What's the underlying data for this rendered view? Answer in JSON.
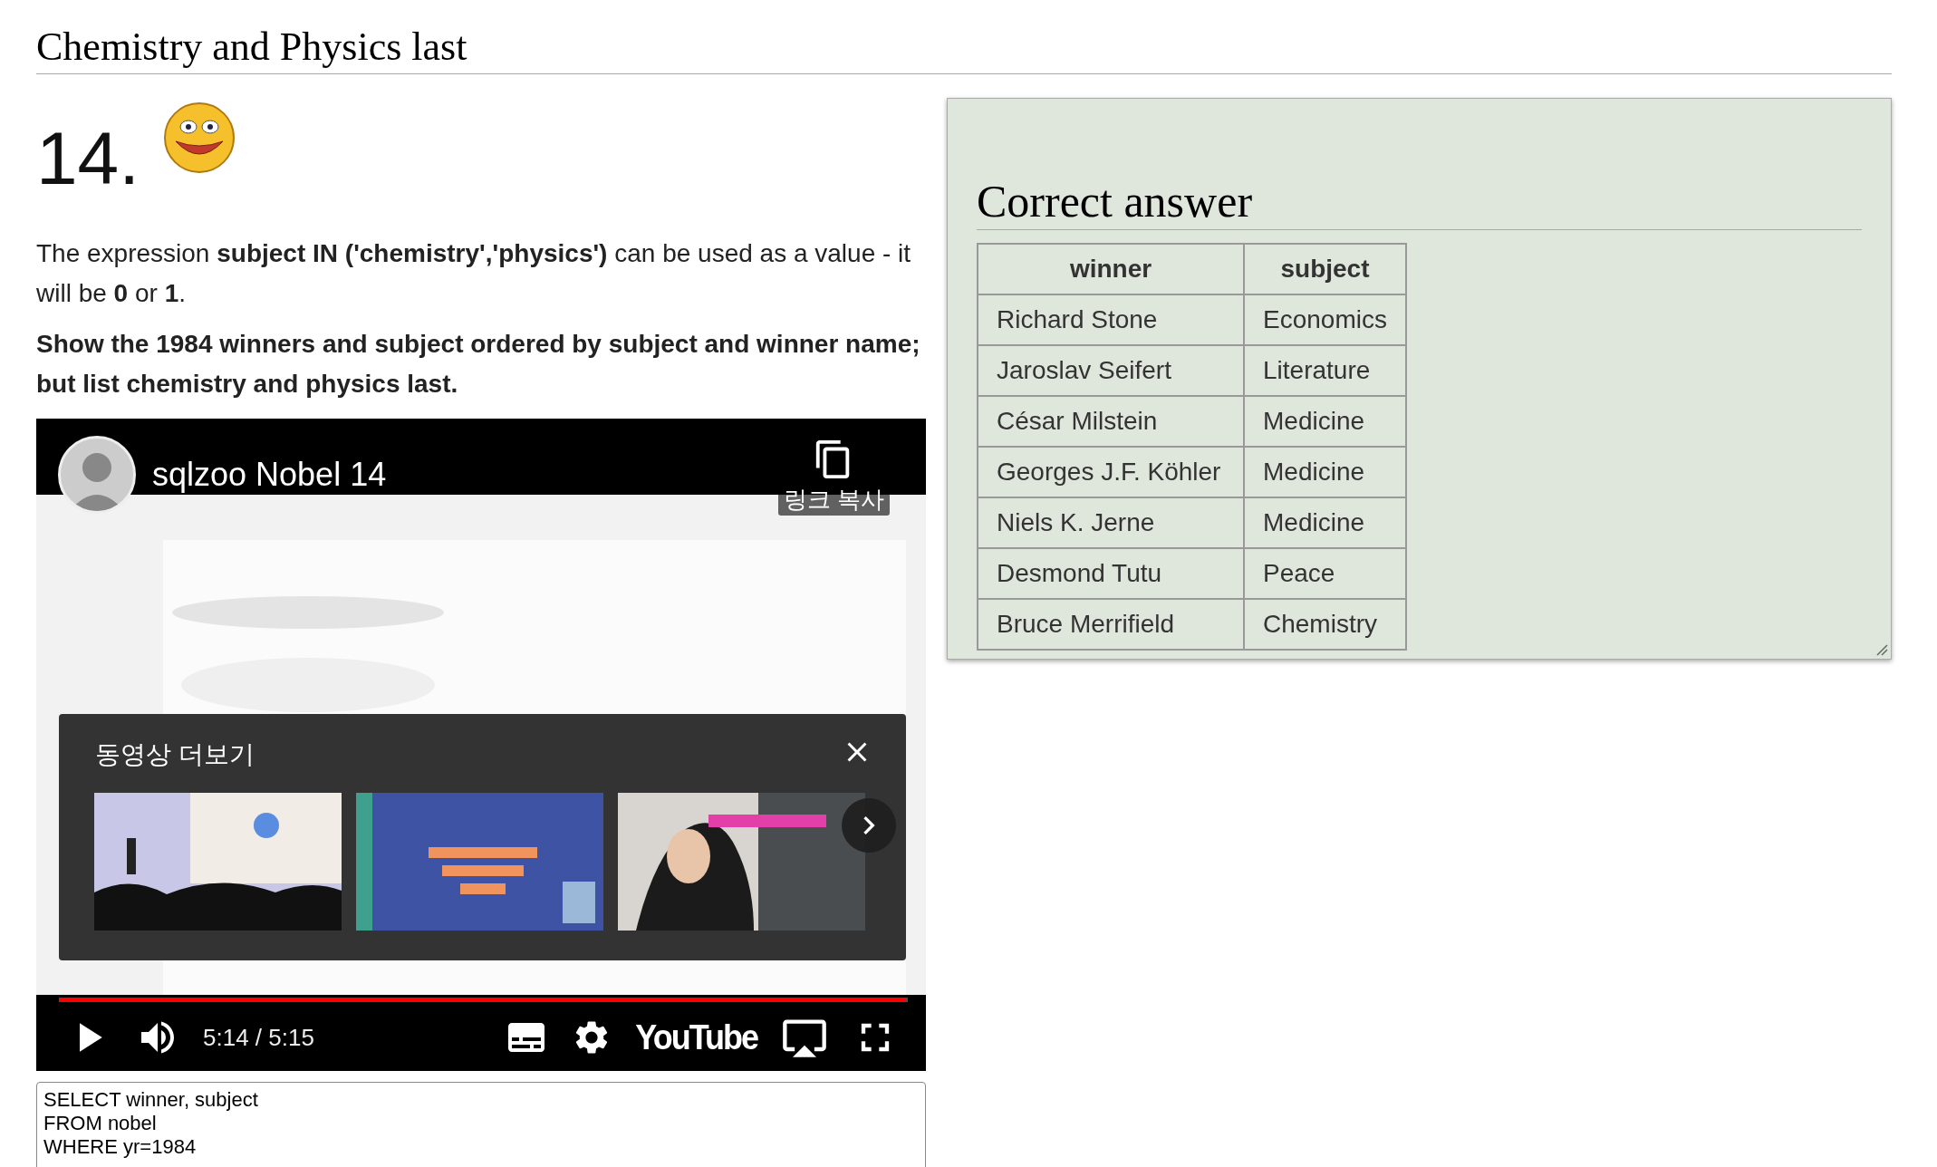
{
  "page_title": "Chemistry and Physics last",
  "question": {
    "number": "14.",
    "intro": "The expression **subject IN ('chemistry','physics')** can be used as a value - it will be **0** or **1**.",
    "task": "Show the 1984 winners and subject ordered by subject and winner name; but list chemistry and physics last."
  },
  "video": {
    "title": "sqlzoo Nobel 14",
    "copy_link": "링크 복사",
    "more_videos": {
      "title": "동영상 더보기"
    },
    "progress": {
      "level": 0.997
    },
    "time": "5:14 / 5:15",
    "logo": "YouTube"
  },
  "sql": {
    "lines": [
      "SELECT winner, subject",
      "FROM nobel",
      "WHERE yr=1984"
    ]
  },
  "answer": {
    "title": "Correct answer",
    "columns": [
      "winner",
      "subject"
    ],
    "rows": [
      [
        "Richard Stone",
        "Economics"
      ],
      [
        "Jaroslav Seifert",
        "Literature"
      ],
      [
        "César Milstein",
        "Medicine"
      ],
      [
        "Georges J.F. Köhler",
        "Medicine"
      ],
      [
        "Niels K. Jerne",
        "Medicine"
      ],
      [
        "Desmond Tutu",
        "Peace"
      ],
      [
        "Bruce Merrifield",
        "Chemistry"
      ]
    ]
  }
}
